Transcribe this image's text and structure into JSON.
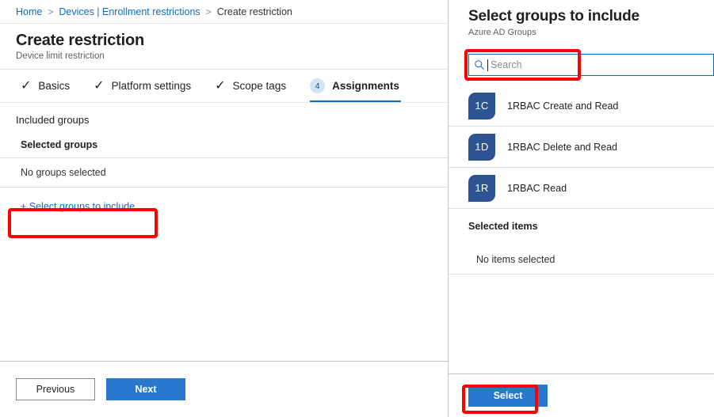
{
  "breadcrumb": {
    "items": [
      {
        "label": "Home",
        "type": "link"
      },
      {
        "label": "Devices | Enrollment restrictions",
        "type": "link"
      },
      {
        "label": "Create restriction",
        "type": "current"
      }
    ],
    "separator": ">"
  },
  "page": {
    "title": "Create restriction",
    "subtitle": "Device limit restriction"
  },
  "tabs": [
    {
      "label": "Basics",
      "state": "complete",
      "marker": "✓"
    },
    {
      "label": "Platform settings",
      "state": "complete",
      "marker": "✓"
    },
    {
      "label": "Scope tags",
      "state": "complete",
      "marker": "✓"
    },
    {
      "label": "Assignments",
      "state": "active",
      "marker": "4"
    }
  ],
  "assignments": {
    "included_groups_label": "Included groups",
    "selected_groups_header": "Selected groups",
    "no_groups_text": "No groups selected",
    "add_link_label": "+ Select groups to include"
  },
  "footer": {
    "previous_label": "Previous",
    "next_label": "Next"
  },
  "panel": {
    "title": "Select groups to include",
    "subtitle": "Azure AD Groups",
    "search": {
      "placeholder": "Search",
      "value": "",
      "icon": "search-icon",
      "focused": true
    },
    "groups": [
      {
        "initials": "1C",
        "name": "1RBAC Create and Read"
      },
      {
        "initials": "1D",
        "name": "1RBAC Delete and Read"
      },
      {
        "initials": "1R",
        "name": "1RBAC Read"
      }
    ],
    "selected_items_header": "Selected items",
    "no_items_text": "No items selected",
    "select_button_label": "Select"
  },
  "colors": {
    "link": "#0f6cbd",
    "primary_button": "#2878cd",
    "avatar": "#2d5490",
    "badge_bg": "#cfe4f7",
    "annotation": "#ff0000"
  }
}
